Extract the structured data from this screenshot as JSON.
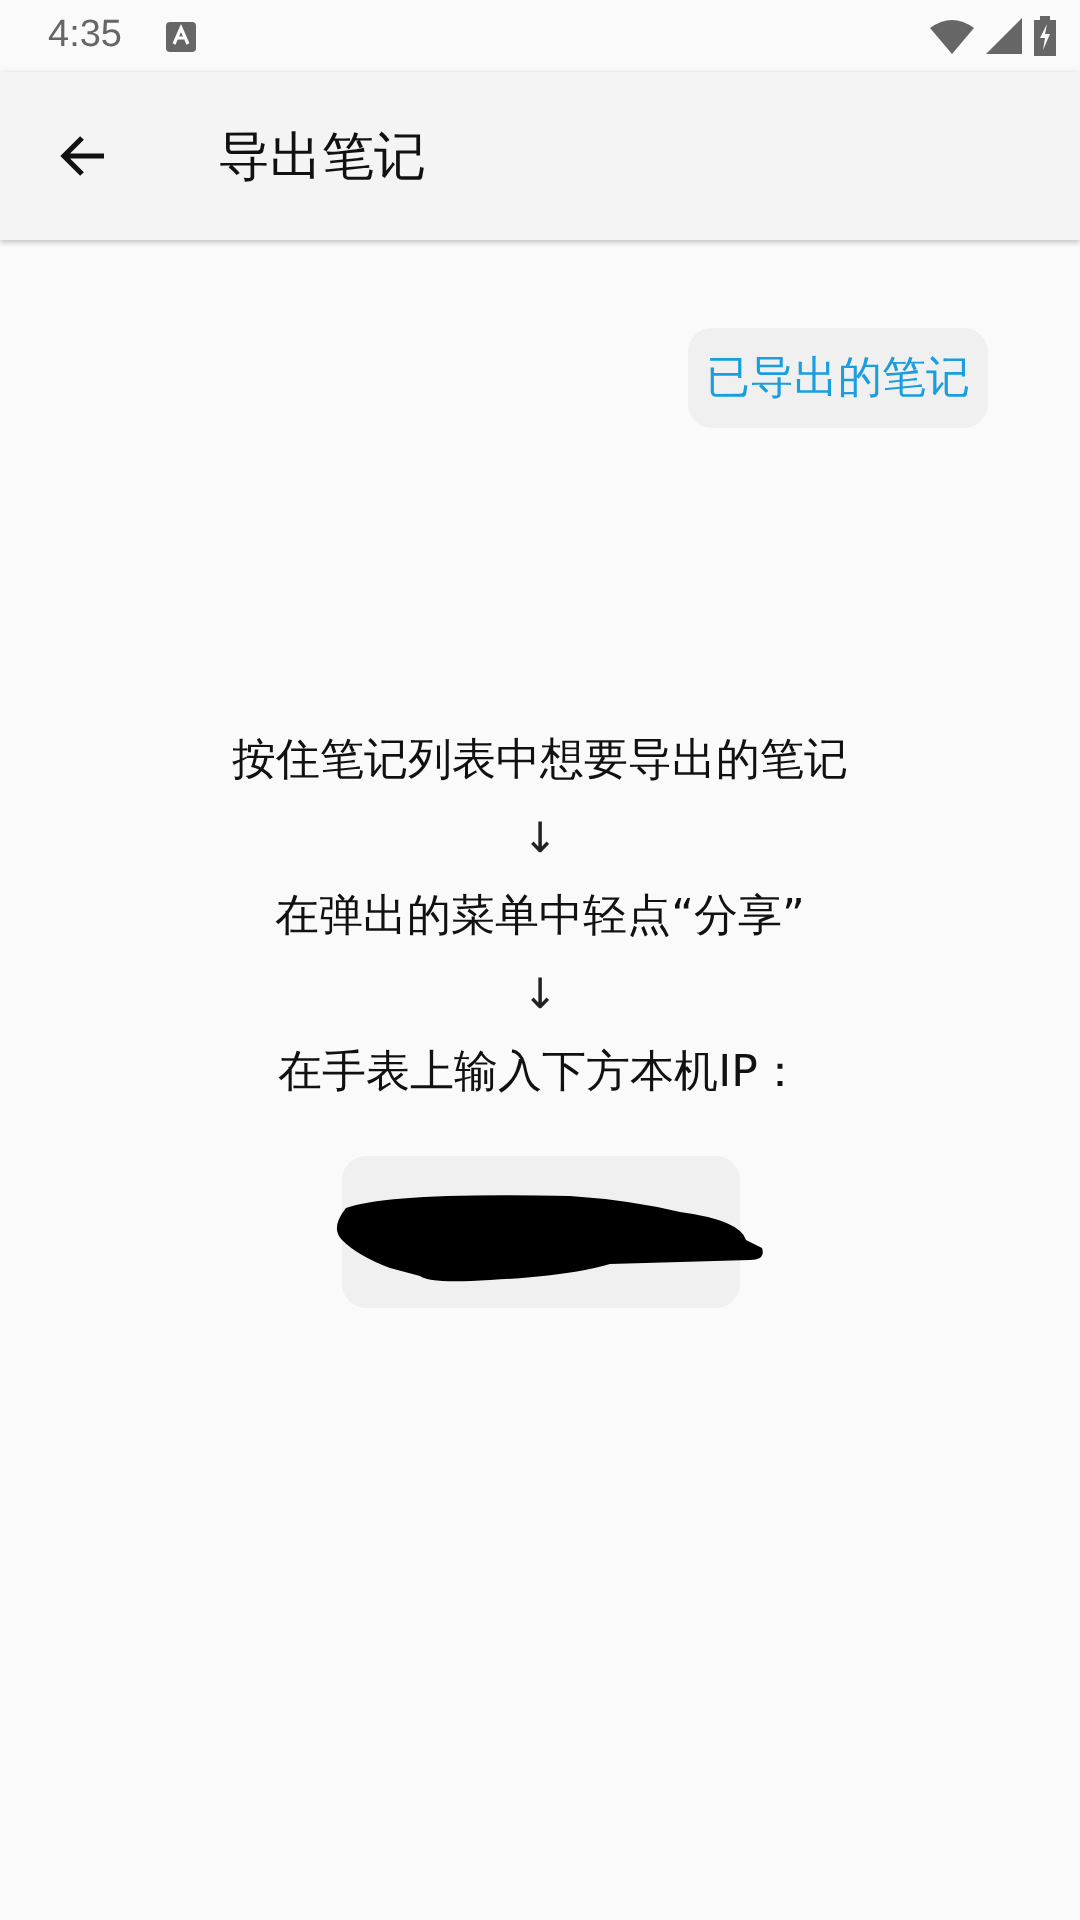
{
  "status_bar": {
    "time": "4:35"
  },
  "app_bar": {
    "title": "导出笔记"
  },
  "exported_notes_button": {
    "label": "已导出的笔记"
  },
  "instructions": [
    {
      "kind": "step",
      "text": "按住笔记列表中想要导出的笔记"
    },
    {
      "kind": "arrow",
      "text": "↓"
    },
    {
      "kind": "step",
      "text": "在弹出的菜单中轻点“分享”"
    },
    {
      "kind": "arrow",
      "text": "↓"
    },
    {
      "kind": "step",
      "text": "在手表上输入下方本机IP："
    }
  ],
  "ip_box": {
    "redacted": true
  }
}
